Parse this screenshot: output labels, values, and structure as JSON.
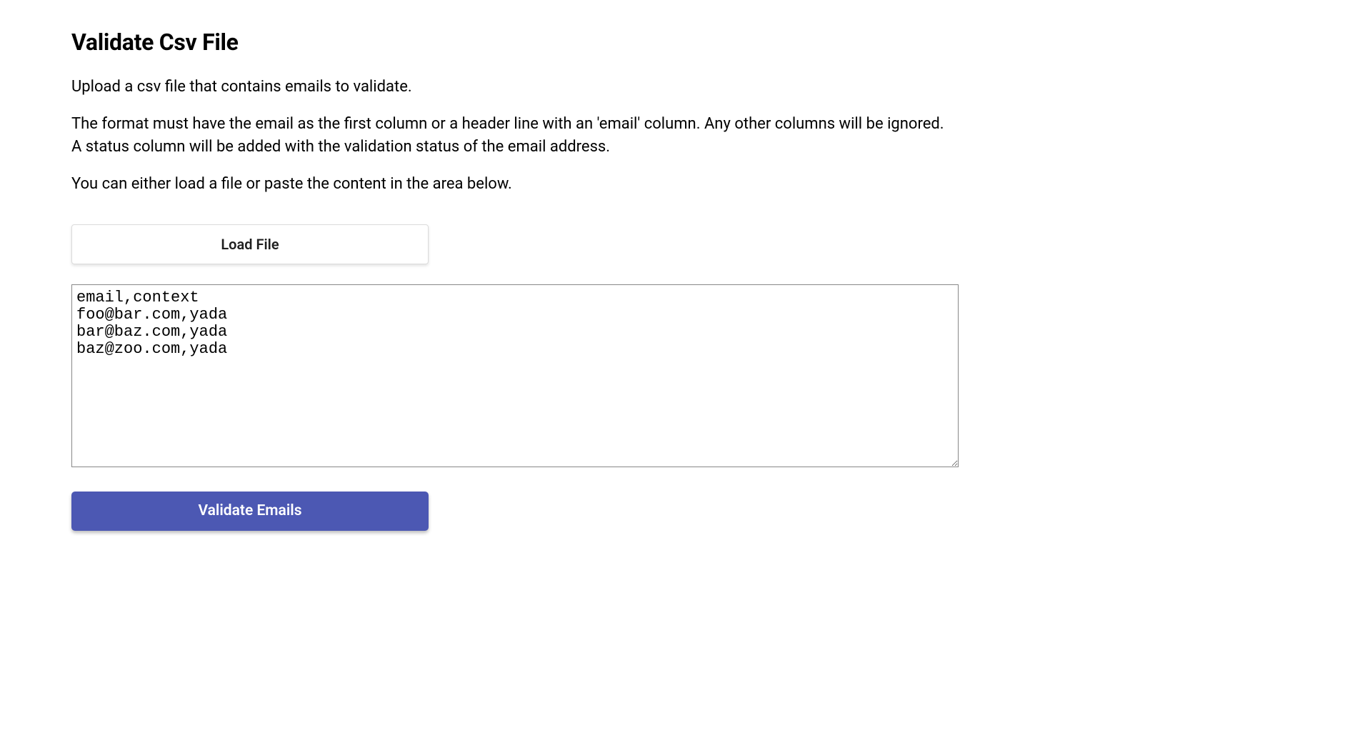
{
  "page": {
    "title": "Validate Csv File",
    "description1": "Upload a csv file that contains emails to validate.",
    "description2": "The format must have the email as the first column or a header line with an 'email' column. Any other columns will be ignored. A status column will be added with the validation status of the email address.",
    "description3": "You can either load a file or paste the content in the area below."
  },
  "buttons": {
    "load_file": "Load File",
    "validate": "Validate Emails"
  },
  "textarea": {
    "value": "email,context\nfoo@bar.com,yada\nbar@baz.com,yada\nbaz@zoo.com,yada"
  },
  "colors": {
    "primary": "#4c58b3"
  }
}
